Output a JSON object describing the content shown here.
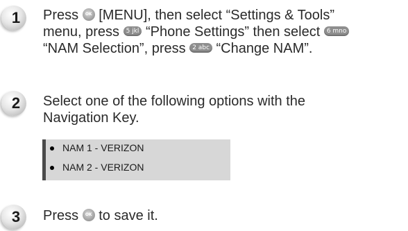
{
  "steps": [
    {
      "number": "1",
      "lines": {
        "l1_a": "Press",
        "l1_key": "OK",
        "l1_b": "[MENU], then select “Settings & Tools”",
        "l2_a": "menu, press",
        "l2_key": "5 jkl",
        "l2_b": "“Phone Settings” then select",
        "l2_key2": "6 mno",
        "l3_a": "“NAM Selection”, press",
        "l3_key": "2 abc",
        "l3_b": "“Change NAM”."
      }
    },
    {
      "number": "2",
      "lines": {
        "l1": "Select one of the following options with the",
        "l2": "Navigation Key."
      }
    },
    {
      "number": "3",
      "lines": {
        "l1_a": "Press",
        "l1_key": "OK",
        "l1_b": "to save it."
      }
    }
  ],
  "options": [
    "NAM 1 - VERIZON",
    "NAM 2 - VERIZON"
  ]
}
